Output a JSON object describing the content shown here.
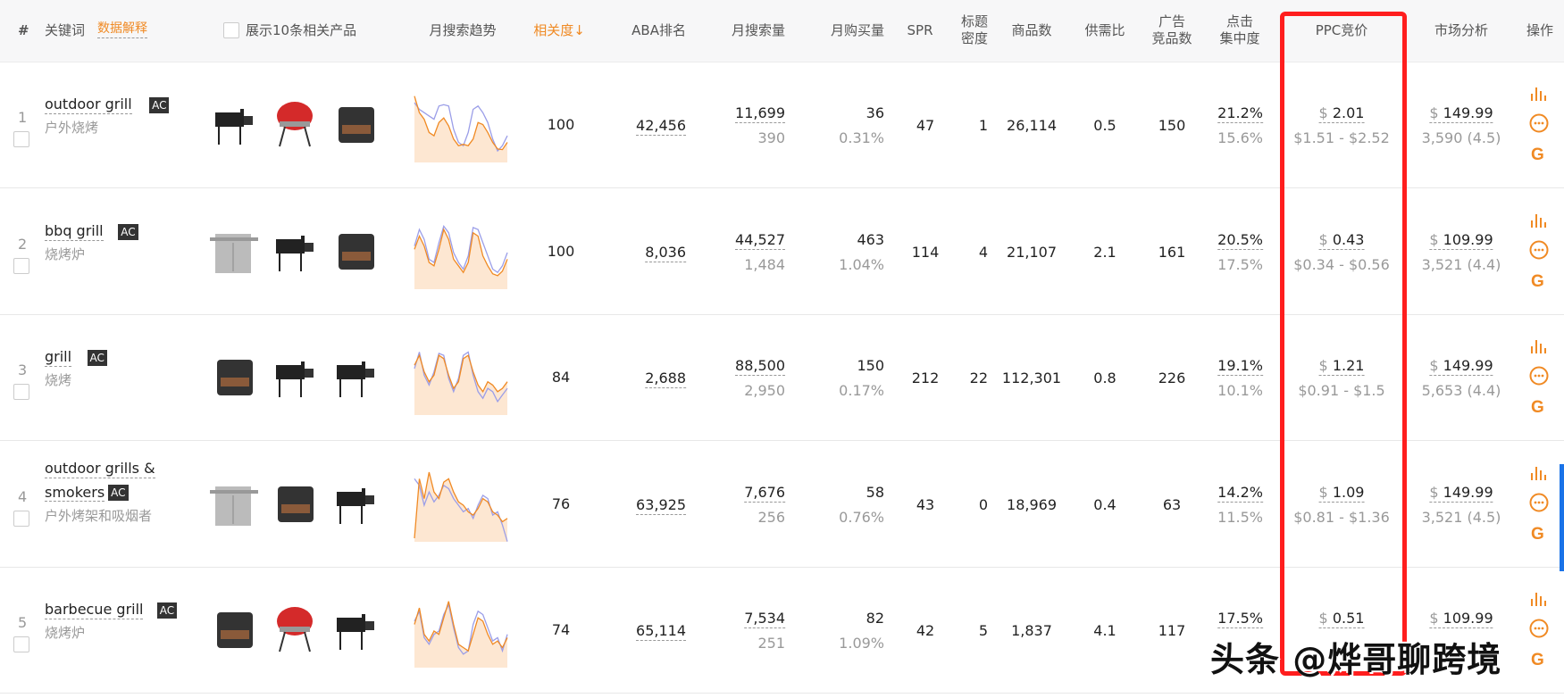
{
  "header": {
    "index": "#",
    "keyword": "关键词",
    "data_explain": "数据解释",
    "show_products": "展示10条相关产品",
    "trend": "月搜索趋势",
    "relevance": "相关度↓",
    "aba": "ABA排名",
    "monthly_search": "月搜索量",
    "monthly_purchase": "月购买量",
    "spr": "SPR",
    "title_density": "标题\n密度",
    "product_count": "商品数",
    "supply_demand": "供需比",
    "ad_products": "广告\n竞品数",
    "click_conc": "点击\n集中度",
    "ppc": "PPC竞价",
    "market": "市场分析",
    "ops": "操作"
  },
  "badge": "AC",
  "rows": [
    {
      "idx": "1",
      "kw": "outdoor grill",
      "kw2": "",
      "cn": "户外烧烤",
      "rel": "100",
      "aba": "42,456",
      "search": "11,699",
      "search2": "390",
      "buy": "36",
      "buy2": "0.31%",
      "spr": "47",
      "td": "1",
      "pc": "26,114",
      "sd": "0.5",
      "ad": "150",
      "cc": "21.2%",
      "cc2": "15.6%",
      "ppc": "2.01",
      "ppc_range": "$1.51 - $2.52",
      "price": "149.99",
      "mkt": "3,590 (4.5)",
      "trend_a": [
        95,
        70,
        60,
        40,
        35,
        55,
        62,
        50,
        30,
        20,
        22,
        20,
        30,
        55,
        52,
        40,
        25,
        15,
        14,
        25
      ],
      "trend_b": [
        85,
        75,
        70,
        65,
        60,
        80,
        82,
        80,
        45,
        25,
        20,
        40,
        75,
        80,
        70,
        55,
        30,
        12,
        20,
        35
      ]
    },
    {
      "idx": "2",
      "kw": "bbq grill",
      "kw2": "",
      "cn": "烧烤炉",
      "rel": "100",
      "aba": "8,036",
      "search": "44,527",
      "search2": "1,484",
      "buy": "463",
      "buy2": "1.04%",
      "spr": "114",
      "td": "4",
      "pc": "21,107",
      "sd": "2.1",
      "ad": "161",
      "cc": "20.5%",
      "cc2": "17.5%",
      "ppc": "0.43",
      "ppc_range": "$0.34 - $0.56",
      "price": "109.99",
      "mkt": "3,521 (4.4)",
      "trend_a": [
        55,
        75,
        60,
        35,
        30,
        55,
        85,
        70,
        40,
        30,
        20,
        35,
        80,
        75,
        45,
        30,
        18,
        15,
        22,
        40
      ],
      "trend_b": [
        60,
        85,
        70,
        40,
        35,
        65,
        90,
        80,
        50,
        35,
        25,
        45,
        88,
        85,
        65,
        45,
        25,
        20,
        30,
        50
      ]
    },
    {
      "idx": "3",
      "kw": "grill",
      "kw2": "",
      "cn": "烧烤",
      "rel": "84",
      "aba": "2,688",
      "search": "88,500",
      "search2": "2,950",
      "buy": "150",
      "buy2": "0.17%",
      "spr": "212",
      "td": "22",
      "pc": "112,301",
      "sd": "0.8",
      "ad": "226",
      "cc": "19.1%",
      "cc2": "10.1%",
      "ppc": "1.21",
      "ppc_range": "$0.91 - $1.5",
      "price": "149.99",
      "mkt": "5,653 (4.4)",
      "trend_a": [
        70,
        85,
        60,
        45,
        55,
        85,
        80,
        55,
        35,
        45,
        80,
        85,
        60,
        40,
        30,
        45,
        40,
        30,
        35,
        45
      ],
      "trend_b": [
        65,
        90,
        55,
        40,
        60,
        88,
        85,
        50,
        30,
        50,
        85,
        90,
        55,
        30,
        20,
        35,
        30,
        15,
        25,
        35
      ]
    },
    {
      "idx": "4",
      "kw": "outdoor grills &",
      "kw2": "smokers",
      "cn": "户外烤架和吸烟者",
      "rel": "76",
      "aba": "63,925",
      "search": "7,676",
      "search2": "256",
      "buy": "58",
      "buy2": "0.76%",
      "spr": "43",
      "td": "0",
      "pc": "18,969",
      "sd": "0.4",
      "ad": "63",
      "cc": "14.2%",
      "cc2": "11.5%",
      "ppc": "1.09",
      "ppc_range": "$0.81 - $1.36",
      "price": "149.99",
      "mkt": "3,521 (4.5)",
      "trend_a": [
        0,
        90,
        60,
        100,
        70,
        60,
        85,
        90,
        70,
        55,
        50,
        40,
        35,
        45,
        60,
        55,
        40,
        35,
        25,
        30
      ],
      "trend_b": [
        90,
        80,
        50,
        70,
        55,
        65,
        80,
        75,
        60,
        50,
        40,
        45,
        30,
        50,
        65,
        60,
        35,
        40,
        20,
        -5
      ]
    },
    {
      "idx": "5",
      "kw": "barbecue grill",
      "kw2": "",
      "cn": "烧烤炉",
      "rel": "74",
      "aba": "65,114",
      "search": "7,534",
      "search2": "251",
      "buy": "82",
      "buy2": "1.09%",
      "spr": "42",
      "td": "5",
      "pc": "1,837",
      "sd": "4.1",
      "ad": "117",
      "cc": "17.5%",
      "cc2": "",
      "ppc": "0.51",
      "ppc_range": "",
      "price": "109.99",
      "mkt": "",
      "trend_a": [
        60,
        85,
        45,
        35,
        50,
        45,
        70,
        95,
        60,
        30,
        25,
        20,
        45,
        70,
        65,
        45,
        30,
        35,
        25,
        40
      ],
      "trend_b": [
        65,
        80,
        40,
        30,
        45,
        50,
        75,
        90,
        55,
        25,
        15,
        20,
        60,
        80,
        75,
        55,
        35,
        40,
        20,
        45
      ]
    }
  ],
  "watermark": "头条 @烨哥聊跨境",
  "colors": {
    "accent": "#f08a24",
    "trend_b": "#9b9ee8",
    "highlight": "#ff1e1e"
  }
}
